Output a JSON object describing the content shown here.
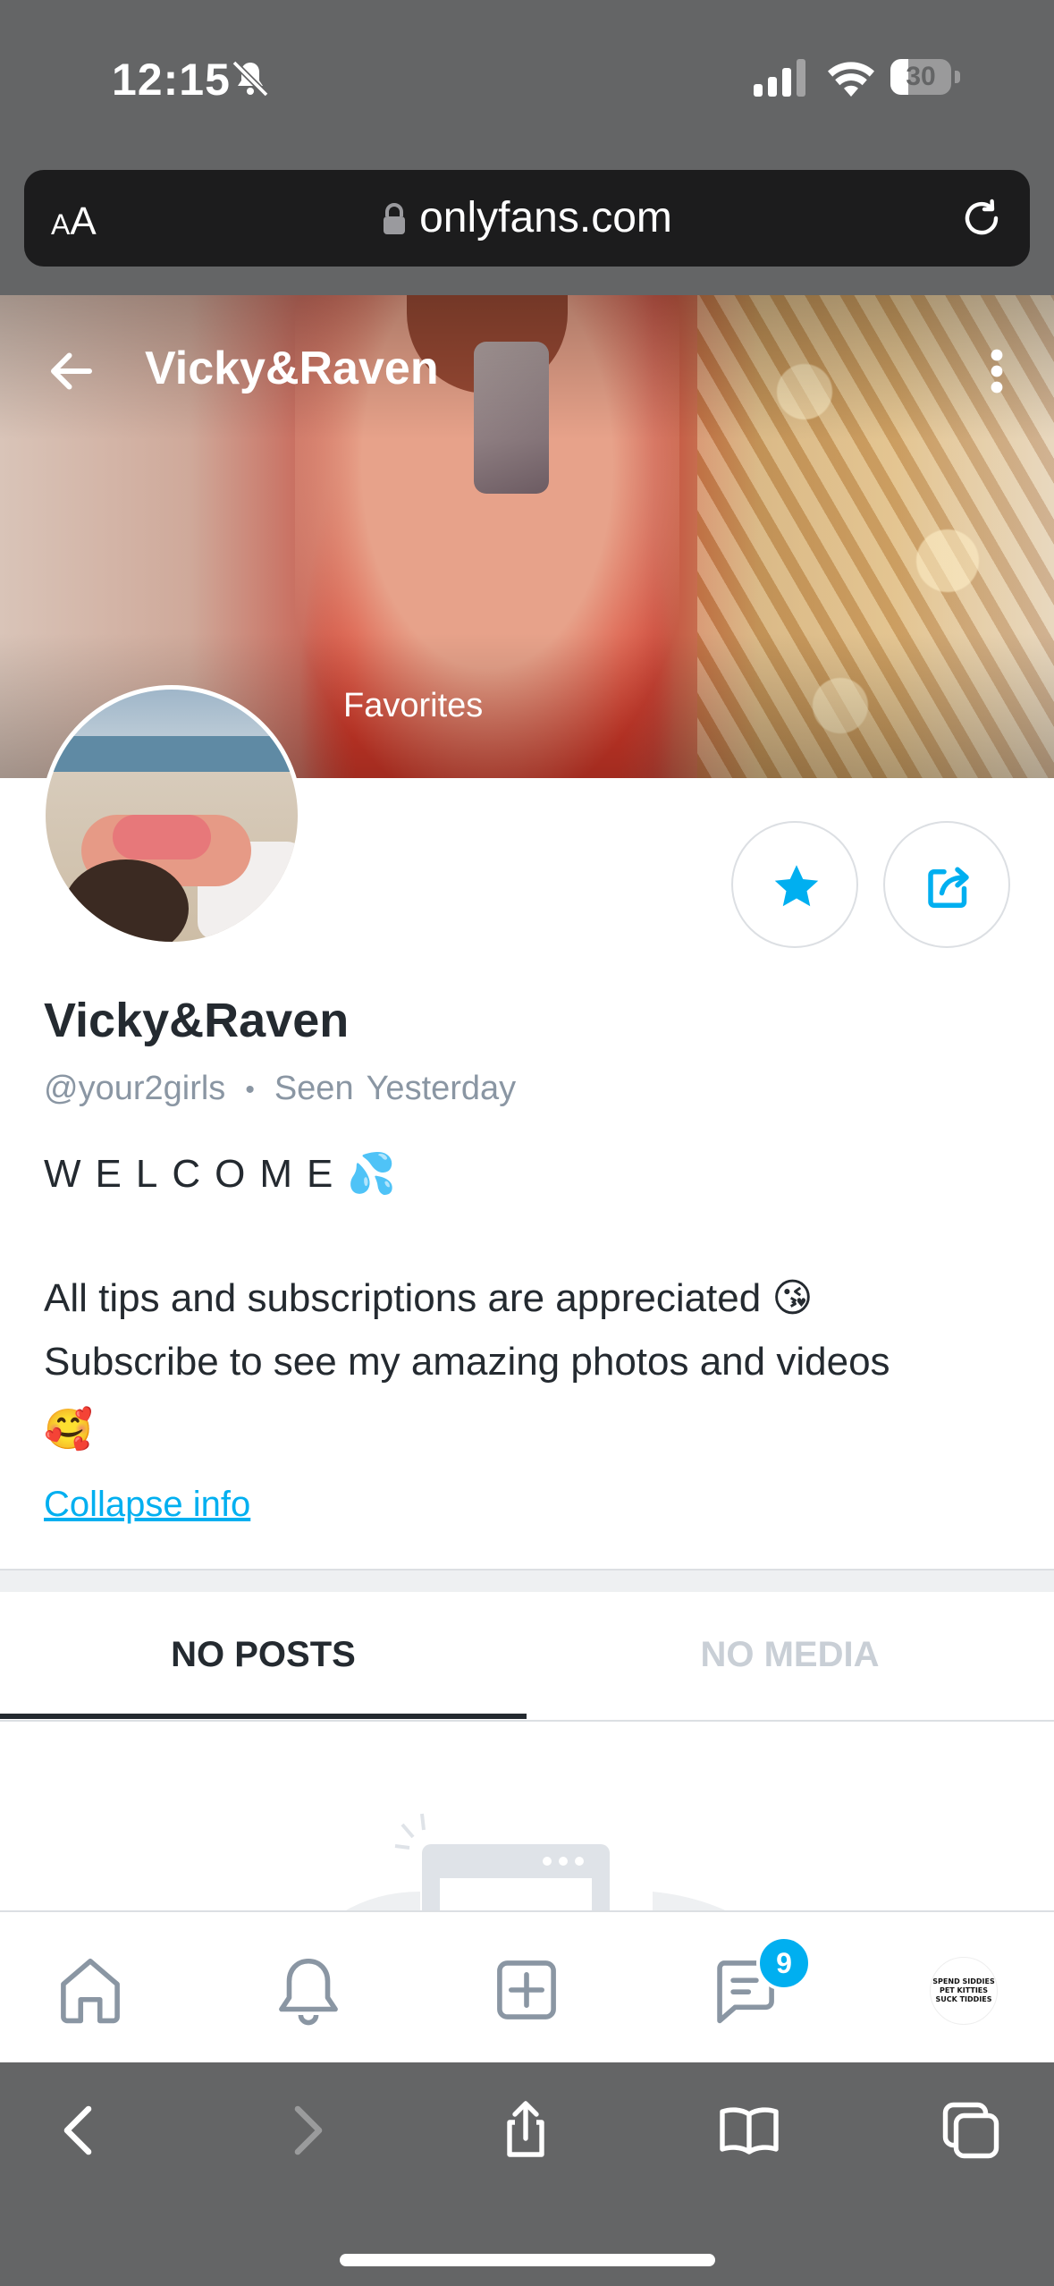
{
  "status_bar": {
    "time": "12:15",
    "battery_percent": 30,
    "battery_label": "30",
    "icons": [
      "bell-slash-icon",
      "signal-icon",
      "wifi-icon",
      "battery-icon"
    ]
  },
  "browser": {
    "text_size_label_small": "A",
    "text_size_label_large": "A",
    "url": "onlyfans.com",
    "icons": [
      "lock-icon",
      "reload-icon"
    ]
  },
  "header": {
    "title": "Vicky&Raven",
    "cover_label": "Favorites",
    "icons": [
      "back-arrow-icon",
      "more-vertical-icon"
    ]
  },
  "profile": {
    "name": "Vicky&Raven",
    "handle": "@your2girls",
    "separator": "•",
    "seen_label": "Seen",
    "seen_value": "Yesterday",
    "bio_welcome": "WELCOME💦",
    "bio_line_1": "All tips and subscriptions are appreciated 😘",
    "bio_line_2": "Subscribe to see my amazing photos and videos",
    "bio_line_3": "🥰",
    "collapse_link": "Collapse info"
  },
  "actions": {
    "favorite_icon": "star-icon",
    "share_icon": "share-icon"
  },
  "tabs": [
    {
      "label": "NO POSTS",
      "active": true
    },
    {
      "label": "NO MEDIA",
      "active": false
    }
  ],
  "bottom_nav": {
    "items": [
      "home-icon",
      "bell-icon",
      "add-post-icon",
      "messages-icon",
      "profile-avatar"
    ],
    "messages_badge": "9",
    "profile_avatar_text": [
      "SPEND SIDDIES",
      "PET KITTIES",
      "SUCK TIDDIES"
    ]
  },
  "safari_toolbar": {
    "items": [
      "back-icon",
      "forward-icon",
      "share-icon",
      "bookmarks-icon",
      "tabs-icon"
    ]
  },
  "colors": {
    "accent": "#00aff0",
    "browser_chrome": "#646566",
    "text_primary": "#242a30",
    "text_secondary": "#8a96a3"
  }
}
